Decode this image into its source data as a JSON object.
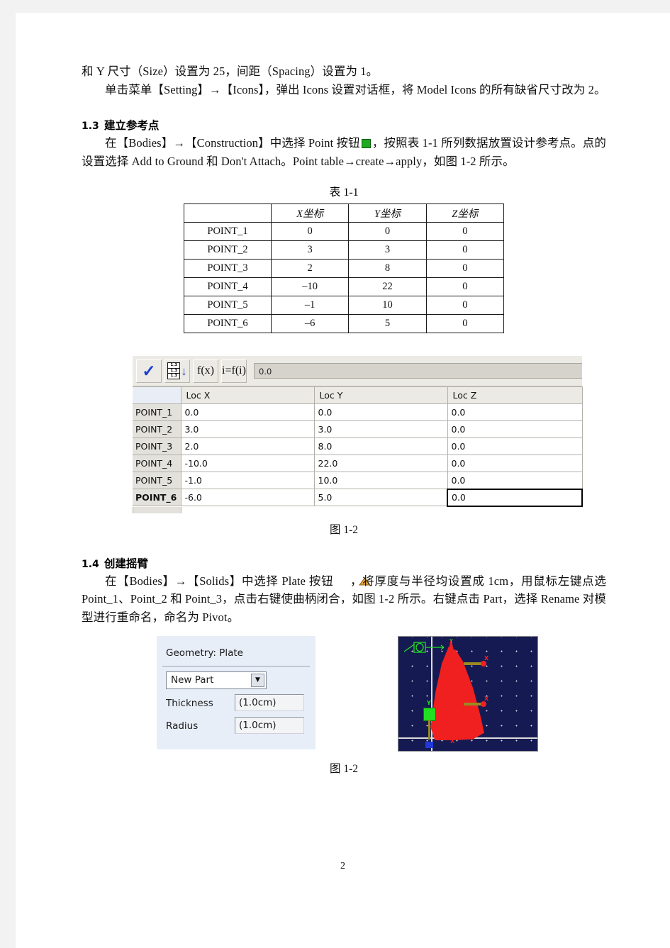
{
  "page": {
    "number": "2"
  },
  "paragraphs": {
    "p_top": "和 Y 尺寸（Size）设置为 25，间距（Spacing）设置为 1。",
    "p_icons": "单击菜单【Setting】→【Icons】，弹出 Icons 设置对话框，将 Model Icons  的所有缺省尺寸改为 2。"
  },
  "sections": {
    "s13": {
      "num": "1.3",
      "title": "建立参考点"
    },
    "s14": {
      "num": "1.4",
      "title": "创建摇臂"
    }
  },
  "s13_text": {
    "part1": "在【Bodies】→【Construction】中选择 Point 按钮",
    "part2": "，按照表 1-1 所列数据放置设计参考点。点的设置选择 Add to Ground 和 Don't Attach。Point table→create→apply，如图 1-2 所示。"
  },
  "s14_text": {
    "part1": "在【Bodies】→【Solids】中选择 Plate 按钮",
    "part2": "，将厚度与半径均设置成 1cm，用鼠标左键点选 Point_1、Point_2 和 Point_3，点击右键使曲柄闭合，如图 1-2 所示。右键点击 Part，选择 Rename 对模型进行重命名，命名为 Pivot。"
  },
  "table_11": {
    "caption": "表 1-1",
    "columns": [
      "",
      "X坐标",
      "Y坐标",
      "Z坐标"
    ],
    "rows": [
      {
        "name": "POINT_1",
        "x": "0",
        "y": "0",
        "z": "0"
      },
      {
        "name": "POINT_2",
        "x": "3",
        "y": "3",
        "z": "0"
      },
      {
        "name": "POINT_3",
        "x": "2",
        "y": "8",
        "z": "0"
      },
      {
        "name": "POINT_4",
        "x": "–10",
        "y": "22",
        "z": "0"
      },
      {
        "name": "POINT_5",
        "x": "–1",
        "y": "10",
        "z": "0"
      },
      {
        "name": "POINT_6",
        "x": "–6",
        "y": "5",
        "z": "0"
      }
    ]
  },
  "adams_table_editor": {
    "toolbar": {
      "apply_icon": "✓",
      "fill_down_icon_lines": [
        "1.3",
        "1.3",
        "1.3"
      ],
      "fill_down_arrow": "↓",
      "function_label": "f(x)",
      "iterative_function_label": "i=f(i)",
      "value_field": "0.0"
    },
    "columns": [
      "",
      "Loc X",
      "Loc Y",
      "Loc Z"
    ],
    "rows": [
      {
        "name": "POINT_1",
        "locx": "0.0",
        "locy": "0.0",
        "locz": "0.0"
      },
      {
        "name": "POINT_2",
        "locx": "3.0",
        "locy": "3.0",
        "locz": "0.0"
      },
      {
        "name": "POINT_3",
        "locx": "2.0",
        "locy": "8.0",
        "locz": "0.0"
      },
      {
        "name": "POINT_4",
        "locx": "-10.0",
        "locy": "22.0",
        "locz": "0.0"
      },
      {
        "name": "POINT_5",
        "locx": "-1.0",
        "locy": "10.0",
        "locz": "0.0"
      },
      {
        "name": "POINT_6",
        "locx": "-6.0",
        "locy": "5.0",
        "locz": "0.0"
      }
    ],
    "caption": "图 1-2"
  },
  "geometry_dialog": {
    "title": "Geometry: Plate",
    "part_select": "New Part",
    "thickness_label": "Thickness",
    "thickness_value": "(1.0cm)",
    "radius_label": "Radius",
    "radius_value": "(1.0cm)"
  },
  "viewport": {
    "axis_y_label": "Y",
    "axis_x_label": "X",
    "marker_y_label": "Y",
    "marker_x_label": "X",
    "bg_color": "#161a52",
    "part_color": "#f02020",
    "marker_color": "#21e021"
  },
  "figure_caption_2": "图 1-2"
}
